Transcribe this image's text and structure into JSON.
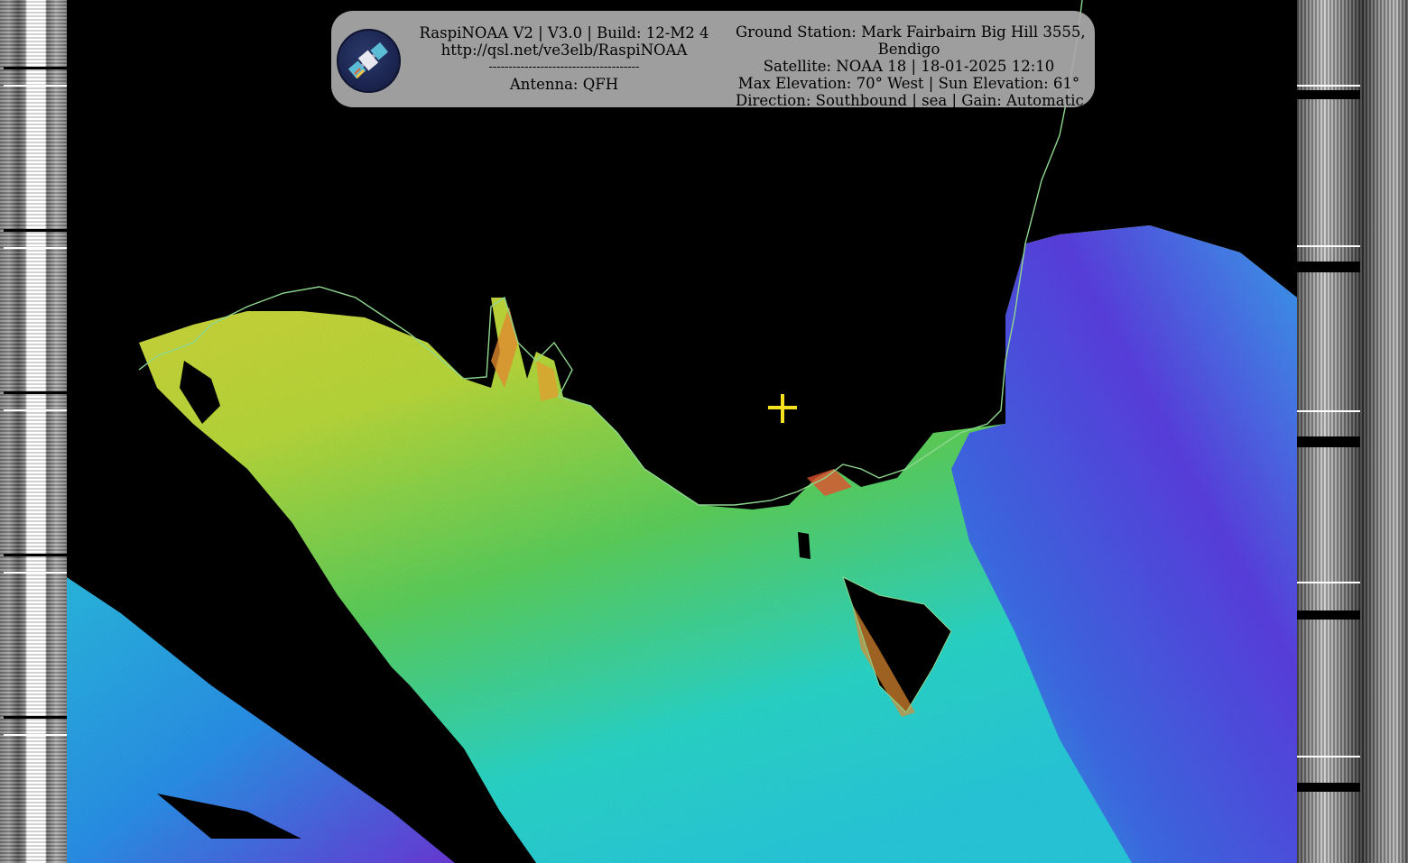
{
  "overlay": {
    "left": {
      "line1": "RaspiNOAA V2 | V3.0 | Build: 12-M2 4",
      "line2": "http://qsl.net/ve3elb/RaspiNOAA",
      "line3": "--------------------------------------",
      "line4": "Antenna: QFH"
    },
    "right": {
      "line1": "Ground Station: Mark Fairbairn Big Hill 3555,",
      "line2": "Bendigo",
      "line3": "Satellite: NOAA 18 | 18-01-2025 12:10",
      "line4": "Max Elevation: 70° West | Sun Elevation: 61°",
      "line5": "Direction: Southbound | sea | Gain: Automatic"
    },
    "logo": "satellite-logo-icon"
  },
  "colors": {
    "overlay_bg": "#aaaaaa",
    "crosshair": "#f5e020",
    "coastline": "#8fd88f",
    "ocean_black": "#000000",
    "false_color_yellow": "#c8d830",
    "false_color_green": "#5ccf5a",
    "false_color_cyan": "#2ad6d0",
    "false_color_blue": "#2f7cf0",
    "false_color_purple": "#6a2fd6"
  },
  "icons": {
    "crosshair": "crosshair-icon"
  }
}
